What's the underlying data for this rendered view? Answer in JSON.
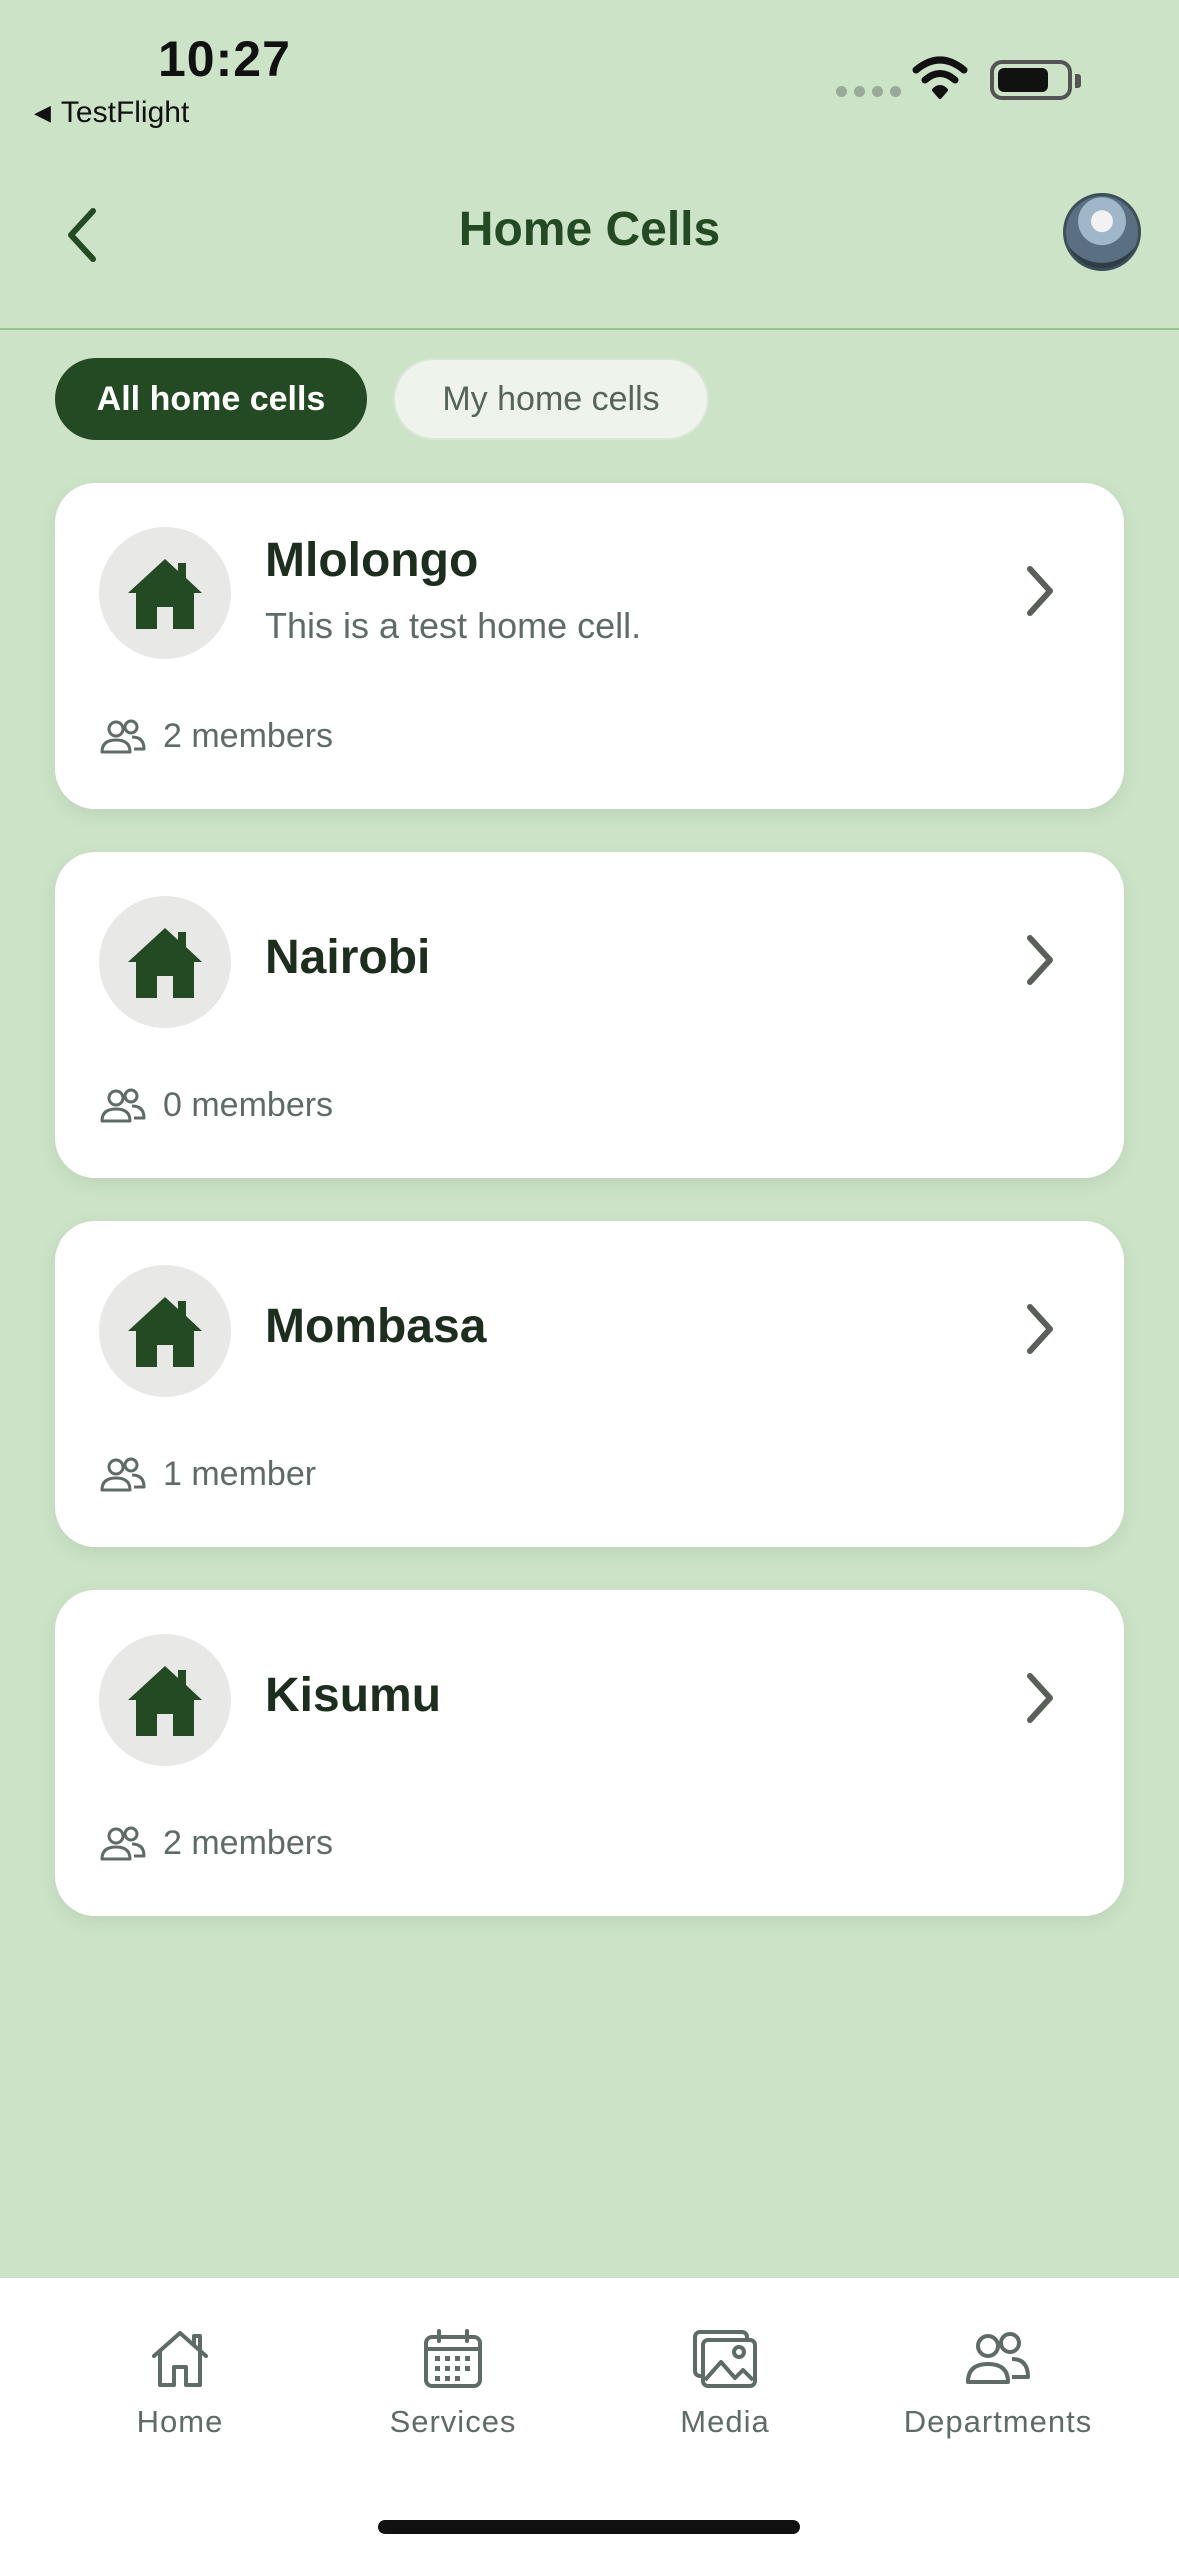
{
  "status_bar": {
    "time": "10:27",
    "back_app": "TestFlight"
  },
  "header": {
    "title": "Home Cells"
  },
  "filters": {
    "all": "All home cells",
    "mine": "My home cells"
  },
  "cells": [
    {
      "name": "Mlolongo",
      "description": "This is a test home cell.",
      "members": "2 members"
    },
    {
      "name": "Nairobi",
      "description": "",
      "members": "0 members"
    },
    {
      "name": "Mombasa",
      "description": "",
      "members": "1 member"
    },
    {
      "name": "Kisumu",
      "description": "",
      "members": "2 members"
    }
  ],
  "tabbar": {
    "items": [
      {
        "label": "Home",
        "icon": "home-icon"
      },
      {
        "label": "Services",
        "icon": "calendar-icon"
      },
      {
        "label": "Media",
        "icon": "image-icon"
      },
      {
        "label": "Departments",
        "icon": "people-icon"
      }
    ]
  },
  "colors": {
    "background": "#cce3c7",
    "accent": "#244a23",
    "card": "#ffffff"
  }
}
